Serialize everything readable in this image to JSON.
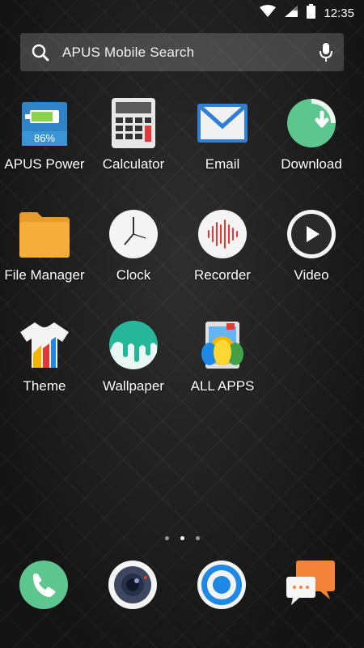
{
  "status_bar": {
    "time": "12:35",
    "icons": [
      "wifi-icon",
      "signal-icon",
      "battery-icon"
    ]
  },
  "search": {
    "placeholder": "APUS Mobile Search",
    "icons": [
      "search-icon",
      "microphone-icon"
    ]
  },
  "apps": [
    {
      "label": "APUS Power",
      "icon": "battery-power-icon",
      "badge": "86%"
    },
    {
      "label": "Calculator",
      "icon": "calculator-icon"
    },
    {
      "label": "Email",
      "icon": "email-icon"
    },
    {
      "label": "Download",
      "icon": "download-icon"
    },
    {
      "label": "File Manager",
      "icon": "folder-icon"
    },
    {
      "label": "Clock",
      "icon": "clock-icon"
    },
    {
      "label": "Recorder",
      "icon": "recorder-icon"
    },
    {
      "label": "Video",
      "icon": "video-play-icon"
    },
    {
      "label": "Theme",
      "icon": "theme-shirt-icon"
    },
    {
      "label": "Wallpaper",
      "icon": "wallpaper-icon"
    },
    {
      "label": "ALL APPS",
      "icon": "all-apps-icon"
    }
  ],
  "pager": {
    "pages": 3,
    "active": 2
  },
  "dock": [
    {
      "icon": "phone-icon"
    },
    {
      "icon": "camera-icon"
    },
    {
      "icon": "browser-icon"
    },
    {
      "icon": "messages-icon"
    }
  ],
  "colors": {
    "power_blue": "#2f84c8",
    "download_green": "#5dc58e",
    "folder_orange": "#f6ae3a",
    "recorder_red": "#e53935",
    "browser_blue": "#1e88e5",
    "message_orange": "#f4833a"
  }
}
